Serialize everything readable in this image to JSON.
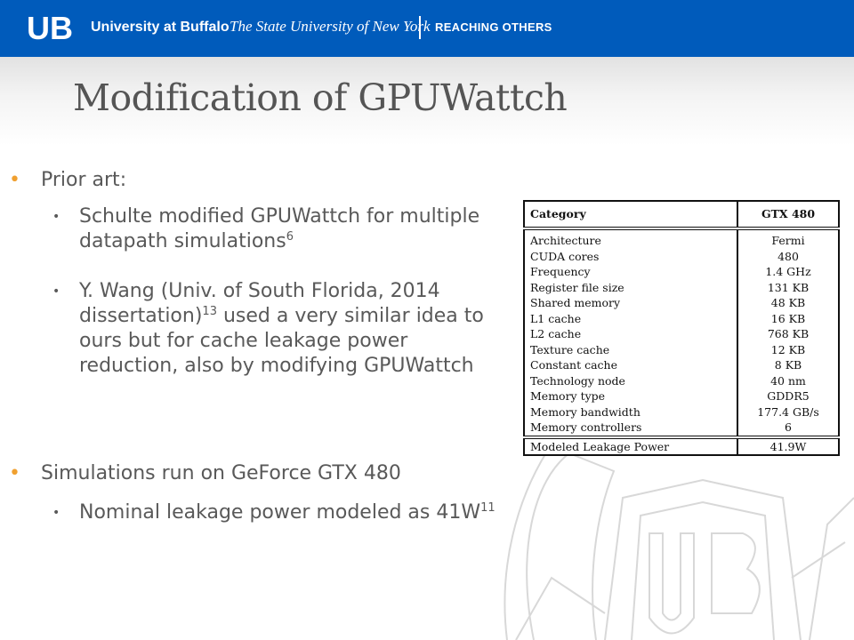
{
  "header": {
    "logo_text": "UB",
    "university": "University at Buffalo",
    "suny": "The State University of New York",
    "tagline": "REACHING OTHERS"
  },
  "slide": {
    "title": "Modification of GPUWattch",
    "bullets": [
      {
        "text": "Prior art:"
      },
      {
        "text": "Schulte modified GPUWattch for multiple datapath simulations",
        "sup": "6"
      },
      {
        "text_a": "Y. Wang (Univ. of South Florida, 2014 dissertation)",
        "sup": "13",
        "text_b": " used a very similar idea to ours but for cache leakage power reduction, also by modifying GPUWattch"
      },
      {
        "text": "Simulations run on GeForce GTX 480"
      },
      {
        "text": "Nominal leakage power modeled as 41W",
        "sup": "11"
      }
    ]
  },
  "table": {
    "headers": [
      "Category",
      "GTX 480"
    ],
    "rows": [
      [
        "Architecture",
        "Fermi"
      ],
      [
        "CUDA cores",
        "480"
      ],
      [
        "Frequency",
        "1.4 GHz"
      ],
      [
        "Register file size",
        "131 KB"
      ],
      [
        "Shared memory",
        "48 KB"
      ],
      [
        "L1 cache",
        "16 KB"
      ],
      [
        "L2 cache",
        "768 KB"
      ],
      [
        "Texture cache",
        "12 KB"
      ],
      [
        "Constant cache",
        "8 KB"
      ],
      [
        "Technology node",
        "40 nm"
      ],
      [
        "Memory type",
        "GDDR5"
      ],
      [
        "Memory bandwidth",
        "177.4 GB/s"
      ],
      [
        "Memory controllers",
        "6"
      ]
    ],
    "footer": [
      "Modeled Leakage Power",
      "41.9W"
    ]
  },
  "colors": {
    "brand_blue": "#005bbb",
    "bullet_orange": "#f0a030",
    "text_gray": "#595959"
  }
}
